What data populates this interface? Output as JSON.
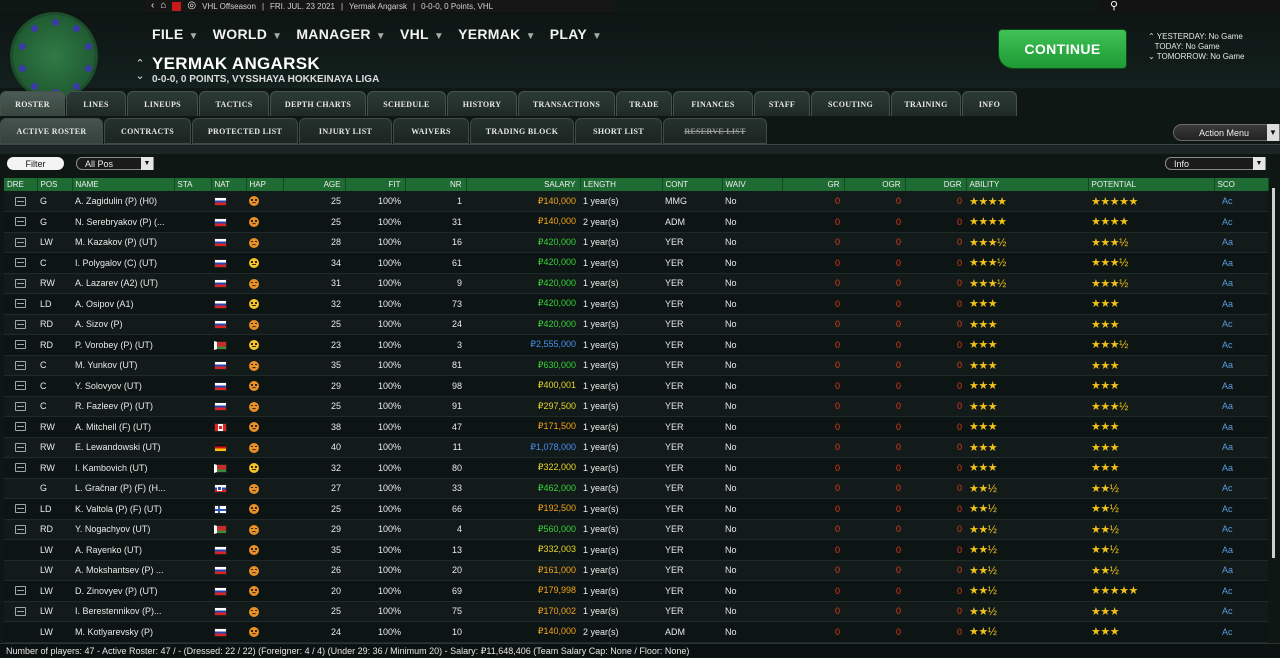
{
  "topbar": {
    "stage": "VHL Offseason",
    "date": "FRI. JUL. 23 2021",
    "team": "Yermak Angarsk",
    "record": "0-0-0, 0 Points, VHL"
  },
  "menu": [
    "FILE",
    "WORLD",
    "MANAGER",
    "VHL",
    "YERMAK",
    "PLAY"
  ],
  "team_header": {
    "name": "YERMAK ANGARSK",
    "subtitle": "0-0-0, 0 POINTS, VYSSHAYA HOKKEINAYA LIGA"
  },
  "continue_label": "CONTINUE",
  "schedule": {
    "yesterday": "YESTERDAY: No Game",
    "today": "TODAY: No Game",
    "tomorrow": "TOMORROW: No Game"
  },
  "main_tabs": [
    "ROSTER",
    "LINES",
    "LINEUPS",
    "TACTICS",
    "DEPTH CHARTS",
    "SCHEDULE",
    "HISTORY",
    "TRANSACTIONS",
    "TRADE",
    "FINANCES",
    "STAFF",
    "SCOUTING",
    "TRAINING",
    "INFO"
  ],
  "sub_tabs": [
    "ACTIVE ROSTER",
    "CONTRACTS",
    "PROTECTED LIST",
    "INJURY LIST",
    "WAIVERS",
    "TRADING BLOCK",
    "SHORT LIST",
    "RESERVE LIST"
  ],
  "action_menu": "Action Menu",
  "filter": {
    "button": "Filter",
    "position_select": "All Pos",
    "view_select": "Info"
  },
  "columns": [
    "DRE",
    "POS",
    "NAME",
    "STA",
    "NAT",
    "HAP",
    "AGE",
    "FIT",
    "NR",
    "SALARY",
    "LENGTH",
    "CONT",
    "WAIV",
    "GR",
    "OGR",
    "DGR",
    "ABILITY",
    "POTENTIAL",
    "SCO"
  ],
  "players": [
    {
      "dre": true,
      "pos": "G",
      "name": "A. Zagidulin (P) (H0)",
      "nat": "russia",
      "hap": "sad",
      "age": "25",
      "fit": "100%",
      "nr": "1",
      "salary": "₽140,000",
      "sal_color": "orange",
      "length": "1 year(s)",
      "cont": "MMG",
      "waiv": "No",
      "gr": "0",
      "ogr": "0",
      "dgr": "0",
      "ability": "★★★★",
      "potential": "★★★★★",
      "sco": "Ac"
    },
    {
      "dre": true,
      "pos": "G",
      "name": "N. Serebryakov (P) (...",
      "nat": "russia",
      "hap": "sad",
      "age": "25",
      "fit": "100%",
      "nr": "31",
      "salary": "₽140,000",
      "sal_color": "orange",
      "length": "2 year(s)",
      "cont": "ADM",
      "waiv": "No",
      "gr": "0",
      "ogr": "0",
      "dgr": "0",
      "ability": "★★★★",
      "potential": "★★★★",
      "sco": "Ac"
    },
    {
      "dre": true,
      "pos": "LW",
      "name": "M. Kazakov (P) (UT)",
      "nat": "russia",
      "hap": "sad",
      "age": "28",
      "fit": "100%",
      "nr": "16",
      "salary": "₽420,000",
      "sal_color": "green",
      "length": "1 year(s)",
      "cont": "YER",
      "waiv": "No",
      "gr": "0",
      "ogr": "0",
      "dgr": "0",
      "ability": "★★★½",
      "potential": "★★★½",
      "sco": "Aa"
    },
    {
      "dre": true,
      "pos": "C",
      "name": "I. Polygalov (C) (UT)",
      "nat": "russia",
      "hap": "ok",
      "age": "34",
      "fit": "100%",
      "nr": "61",
      "salary": "₽420,000",
      "sal_color": "green",
      "length": "1 year(s)",
      "cont": "YER",
      "waiv": "No",
      "gr": "0",
      "ogr": "0",
      "dgr": "0",
      "ability": "★★★½",
      "potential": "★★★½",
      "sco": "Aa"
    },
    {
      "dre": true,
      "pos": "RW",
      "name": "A. Lazarev (A2) (UT)",
      "nat": "russia",
      "hap": "sad",
      "age": "31",
      "fit": "100%",
      "nr": "9",
      "salary": "₽420,000",
      "sal_color": "green",
      "length": "1 year(s)",
      "cont": "YER",
      "waiv": "No",
      "gr": "0",
      "ogr": "0",
      "dgr": "0",
      "ability": "★★★½",
      "potential": "★★★½",
      "sco": "Aa"
    },
    {
      "dre": true,
      "pos": "LD",
      "name": "A. Osipov (A1)",
      "nat": "russia",
      "hap": "ok",
      "age": "32",
      "fit": "100%",
      "nr": "73",
      "salary": "₽420,000",
      "sal_color": "green",
      "length": "1 year(s)",
      "cont": "YER",
      "waiv": "No",
      "gr": "0",
      "ogr": "0",
      "dgr": "0",
      "ability": "★★★",
      "potential": "★★★",
      "sco": "Aa"
    },
    {
      "dre": true,
      "pos": "RD",
      "name": "A. Sizov (P)",
      "nat": "russia",
      "hap": "sad",
      "age": "25",
      "fit": "100%",
      "nr": "24",
      "salary": "₽420,000",
      "sal_color": "green",
      "length": "1 year(s)",
      "cont": "YER",
      "waiv": "No",
      "gr": "0",
      "ogr": "0",
      "dgr": "0",
      "ability": "★★★",
      "potential": "★★★",
      "sco": "Ac"
    },
    {
      "dre": true,
      "pos": "RD",
      "name": "P. Vorobey (P) (UT)",
      "nat": "belarus",
      "hap": "ok",
      "age": "23",
      "fit": "100%",
      "nr": "3",
      "salary": "₽2,555,000",
      "sal_color": "blue",
      "length": "1 year(s)",
      "cont": "YER",
      "waiv": "No",
      "gr": "0",
      "ogr": "0",
      "dgr": "0",
      "ability": "★★★",
      "potential": "★★★½",
      "sco": "Ac"
    },
    {
      "dre": true,
      "pos": "C",
      "name": "M. Yunkov (UT)",
      "nat": "russia",
      "hap": "sad",
      "age": "35",
      "fit": "100%",
      "nr": "81",
      "salary": "₽630,000",
      "sal_color": "green",
      "length": "1 year(s)",
      "cont": "YER",
      "waiv": "No",
      "gr": "0",
      "ogr": "0",
      "dgr": "0",
      "ability": "★★★",
      "potential": "★★★",
      "sco": "Aa"
    },
    {
      "dre": true,
      "pos": "C",
      "name": "Y. Solovyov (UT)",
      "nat": "russia",
      "hap": "sad",
      "age": "29",
      "fit": "100%",
      "nr": "98",
      "salary": "₽400,001",
      "sal_color": "yellow",
      "length": "1 year(s)",
      "cont": "YER",
      "waiv": "No",
      "gr": "0",
      "ogr": "0",
      "dgr": "0",
      "ability": "★★★",
      "potential": "★★★",
      "sco": "Aa"
    },
    {
      "dre": true,
      "pos": "C",
      "name": "R. Fazleev (P) (UT)",
      "nat": "russia",
      "hap": "sad",
      "age": "25",
      "fit": "100%",
      "nr": "91",
      "salary": "₽297,500",
      "sal_color": "yellow",
      "length": "1 year(s)",
      "cont": "YER",
      "waiv": "No",
      "gr": "0",
      "ogr": "0",
      "dgr": "0",
      "ability": "★★★",
      "potential": "★★★½",
      "sco": "Aa"
    },
    {
      "dre": true,
      "pos": "RW",
      "name": "A. Mitchell (F) (UT)",
      "nat": "canada",
      "hap": "sad",
      "age": "38",
      "fit": "100%",
      "nr": "47",
      "salary": "₽171,500",
      "sal_color": "orange",
      "length": "1 year(s)",
      "cont": "YER",
      "waiv": "No",
      "gr": "0",
      "ogr": "0",
      "dgr": "0",
      "ability": "★★★",
      "potential": "★★★",
      "sco": "Aa"
    },
    {
      "dre": true,
      "pos": "RW",
      "name": "E. Lewandowski (UT)",
      "nat": "germany",
      "hap": "sad",
      "age": "40",
      "fit": "100%",
      "nr": "11",
      "salary": "₽1,078,000",
      "sal_color": "blue",
      "length": "1 year(s)",
      "cont": "YER",
      "waiv": "No",
      "gr": "0",
      "ogr": "0",
      "dgr": "0",
      "ability": "★★★",
      "potential": "★★★",
      "sco": "Aa"
    },
    {
      "dre": true,
      "pos": "RW",
      "name": "I. Kambovich (UT)",
      "nat": "belarus",
      "hap": "ok",
      "age": "32",
      "fit": "100%",
      "nr": "80",
      "salary": "₽322,000",
      "sal_color": "yellow",
      "length": "1 year(s)",
      "cont": "YER",
      "waiv": "No",
      "gr": "0",
      "ogr": "0",
      "dgr": "0",
      "ability": "★★★",
      "potential": "★★★",
      "sco": "Aa"
    },
    {
      "dre": false,
      "pos": "G",
      "name": "L. Gračnar (P) (F) (H...",
      "nat": "slovenia",
      "hap": "sad",
      "age": "27",
      "fit": "100%",
      "nr": "33",
      "salary": "₽462,000",
      "sal_color": "green",
      "length": "1 year(s)",
      "cont": "YER",
      "waiv": "No",
      "gr": "0",
      "ogr": "0",
      "dgr": "0",
      "ability": "★★½",
      "potential": "★★½",
      "sco": "Ac"
    },
    {
      "dre": true,
      "pos": "LD",
      "name": "K. Valtola (P) (F) (UT)",
      "nat": "finland",
      "hap": "sad",
      "age": "25",
      "fit": "100%",
      "nr": "66",
      "salary": "₽192,500",
      "sal_color": "orange",
      "length": "1 year(s)",
      "cont": "YER",
      "waiv": "No",
      "gr": "0",
      "ogr": "0",
      "dgr": "0",
      "ability": "★★½",
      "potential": "★★½",
      "sco": "Ac"
    },
    {
      "dre": true,
      "pos": "RD",
      "name": "Y. Nogachyov (UT)",
      "nat": "belarus",
      "hap": "sad",
      "age": "29",
      "fit": "100%",
      "nr": "4",
      "salary": "₽560,000",
      "sal_color": "green",
      "length": "1 year(s)",
      "cont": "YER",
      "waiv": "No",
      "gr": "0",
      "ogr": "0",
      "dgr": "0",
      "ability": "★★½",
      "potential": "★★½",
      "sco": "Ac"
    },
    {
      "dre": false,
      "pos": "LW",
      "name": "A. Rayenko (UT)",
      "nat": "russia",
      "hap": "sad",
      "age": "35",
      "fit": "100%",
      "nr": "13",
      "salary": "₽332,003",
      "sal_color": "yellow",
      "length": "1 year(s)",
      "cont": "YER",
      "waiv": "No",
      "gr": "0",
      "ogr": "0",
      "dgr": "0",
      "ability": "★★½",
      "potential": "★★½",
      "sco": "Aa"
    },
    {
      "dre": false,
      "pos": "LW",
      "name": "A. Mokshantsev (P) ...",
      "nat": "russia",
      "hap": "sad",
      "age": "26",
      "fit": "100%",
      "nr": "20",
      "salary": "₽161,000",
      "sal_color": "orange",
      "length": "1 year(s)",
      "cont": "YER",
      "waiv": "No",
      "gr": "0",
      "ogr": "0",
      "dgr": "0",
      "ability": "★★½",
      "potential": "★★½",
      "sco": "Aa"
    },
    {
      "dre": true,
      "pos": "LW",
      "name": "D. Zinovyev (P) (UT)",
      "nat": "russia",
      "hap": "sad",
      "age": "20",
      "fit": "100%",
      "nr": "69",
      "salary": "₽179,998",
      "sal_color": "orange",
      "length": "1 year(s)",
      "cont": "YER",
      "waiv": "No",
      "gr": "0",
      "ogr": "0",
      "dgr": "0",
      "ability": "★★½",
      "potential": "★★★★★",
      "sco": "Ac"
    },
    {
      "dre": true,
      "pos": "LW",
      "name": "I. Berestennikov (P)...",
      "nat": "russia",
      "hap": "sad",
      "age": "25",
      "fit": "100%",
      "nr": "75",
      "salary": "₽170,002",
      "sal_color": "orange",
      "length": "1 year(s)",
      "cont": "YER",
      "waiv": "No",
      "gr": "0",
      "ogr": "0",
      "dgr": "0",
      "ability": "★★½",
      "potential": "★★★",
      "sco": "Ac"
    },
    {
      "dre": false,
      "pos": "LW",
      "name": "M. Kotlyarevsky (P)",
      "nat": "russia",
      "hap": "sad",
      "age": "24",
      "fit": "100%",
      "nr": "10",
      "salary": "₽140,000",
      "sal_color": "orange",
      "length": "2 year(s)",
      "cont": "ADM",
      "waiv": "No",
      "gr": "0",
      "ogr": "0",
      "dgr": "0",
      "ability": "★★½",
      "potential": "★★★",
      "sco": "Ac"
    }
  ],
  "footer": "Number of players: 47 - Active Roster: 47 / - (Dressed: 22 / 22) (Foreigner: 4 / 4) (Under 29: 36 / Minimum 20) - Salary: ₽11,648,406 (Team Salary Cap: None / Floor: None)"
}
